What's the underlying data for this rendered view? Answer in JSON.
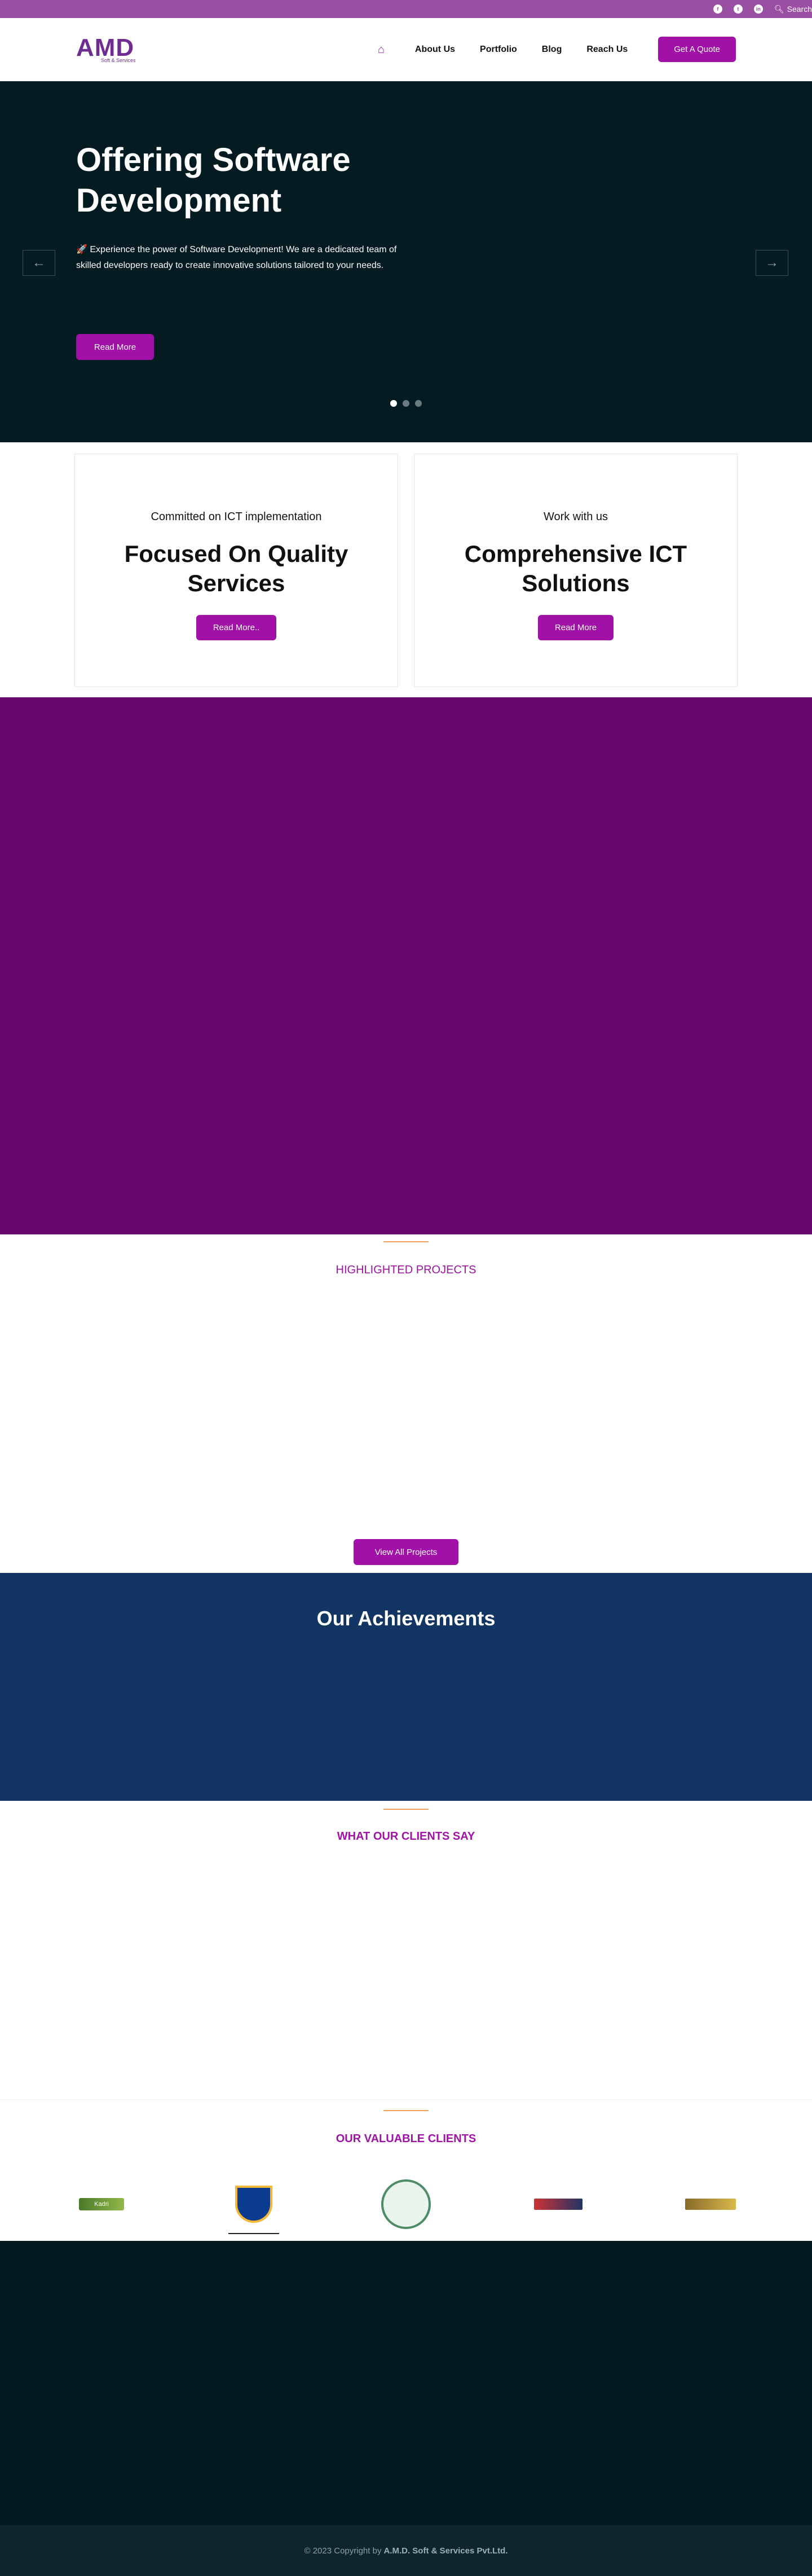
{
  "topbar": {
    "social": [
      "facebook-icon",
      "twitter-icon",
      "linkedin-icon"
    ],
    "search_label": "Search"
  },
  "nav": {
    "logo_text": "AMD",
    "logo_sub": "Soft & Services",
    "items": [
      "About Us",
      "Portfolio",
      "Blog",
      "Reach Us"
    ],
    "quote_label": "Get A Quote"
  },
  "hero": {
    "title": "Offering Software Development",
    "text": "🚀 Experience the power of Software Development! We are a dedicated team of skilled developers ready to create innovative solutions tailored to your needs.",
    "button": "Read More",
    "slides": 3,
    "active_slide": 0
  },
  "cards": [
    {
      "kicker": "Committed on ICT implementation",
      "head": "Focused On Quality Services",
      "button": "Read More.."
    },
    {
      "kicker": "Work with us",
      "head": "Comprehensive ICT Solutions",
      "button": "Read More"
    }
  ],
  "projects": {
    "title": "HIGHLIGHTED PROJECTS",
    "button": "View All Projects"
  },
  "achievements": {
    "title": "Our Achievements"
  },
  "testimonials": {
    "title": "WHAT OUR CLIENTS SAY"
  },
  "clients": {
    "title": "OUR VALUABLE CLIENTS",
    "logos": [
      "kadri-logo",
      "school-crest-logo",
      "seal-logo",
      "company-logo",
      "brand-logo"
    ],
    "logo_text_1": "Kadri"
  },
  "footer": {
    "copyright_prefix": "© 2023 Copyright by",
    "company": "A.M.D. Soft & Services Pvt.Ltd."
  },
  "colors": {
    "accent": "#a211a7",
    "dark": "#031b21",
    "navy": "#133564",
    "purple": "#660770",
    "topbar": "#9b4fa3"
  }
}
